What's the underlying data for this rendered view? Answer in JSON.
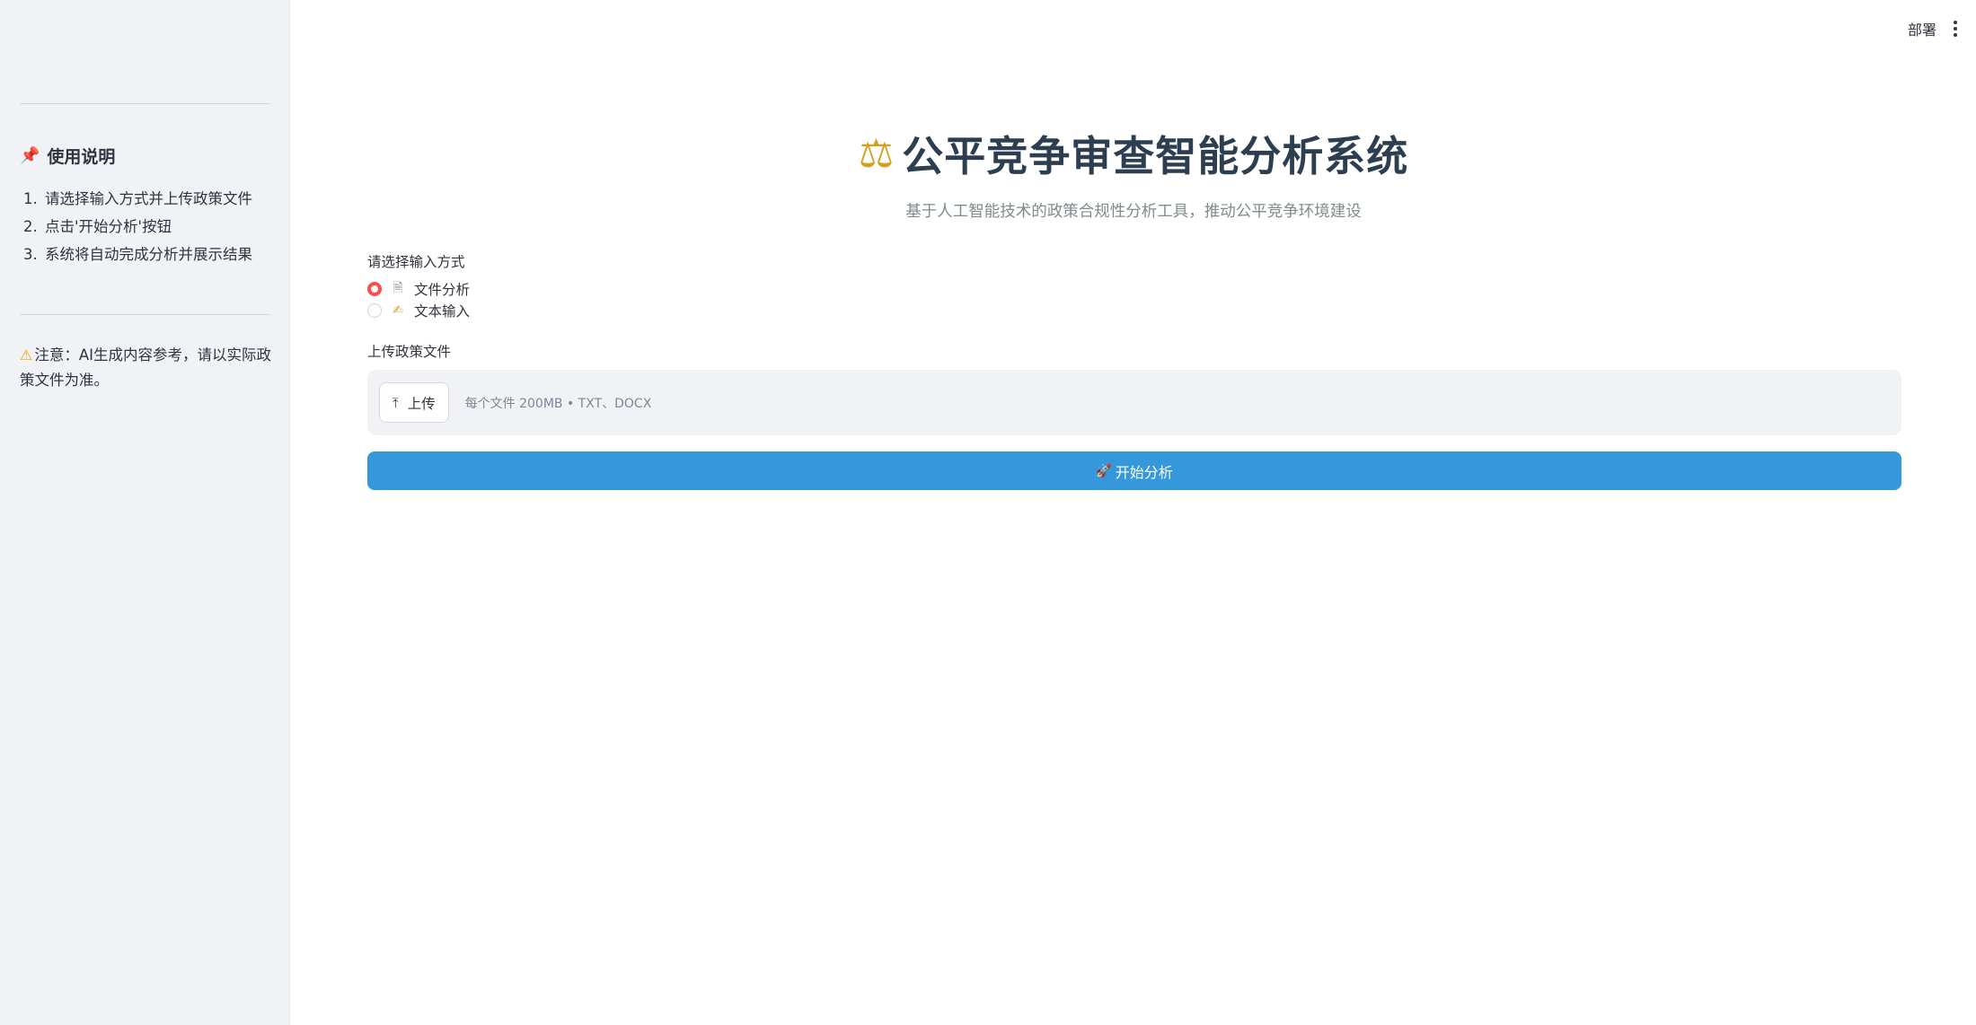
{
  "sidebar": {
    "title": "使用说明",
    "title_icon": "pin-icon",
    "steps": [
      {
        "num": "1.",
        "text": "请选择输入方式并上传政策文件"
      },
      {
        "num": "2.",
        "text": "点击'开始分析'按钮"
      },
      {
        "num": "3.",
        "text": "系统将自动完成分析并展示结果"
      }
    ],
    "note": "注意：AI生成内容参考，请以实际政策文件为准。",
    "note_icon": "warning-icon"
  },
  "topbar": {
    "deploy_label": "部署",
    "menu_icon": "kebab-menu-icon"
  },
  "header": {
    "title": "公平竞争审查智能分析系统",
    "title_icon": "balance-scale-icon",
    "subtitle": "基于人工智能技术的政策合规性分析工具，推动公平竞争环境建设"
  },
  "input_mode": {
    "label": "请选择输入方式",
    "options": [
      {
        "label": "文件分析",
        "icon": "document-icon",
        "selected": true
      },
      {
        "label": "文本输入",
        "icon": "writing-hand-icon",
        "selected": false
      }
    ]
  },
  "upload": {
    "label": "上传政策文件",
    "button_label": "上传",
    "hint": "每个文件 200MB • TXT、DOCX"
  },
  "start_button": {
    "label": "开始分析",
    "icon": "rocket-icon",
    "color": "#3498db"
  },
  "colors": {
    "radio_accent": "#ff4b4b",
    "sidebar_bg": "#f0f2f6",
    "title": "#2c3e50"
  }
}
